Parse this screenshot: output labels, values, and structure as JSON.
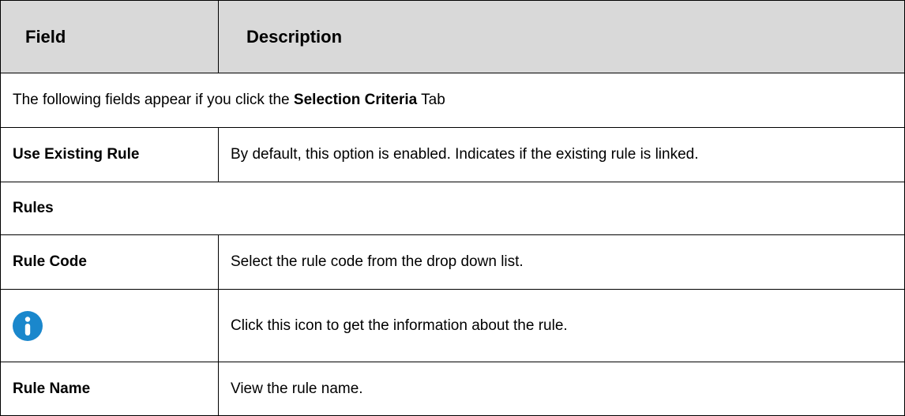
{
  "table": {
    "header": {
      "field": "Field",
      "description": "Description"
    },
    "note": {
      "prefix": "The following fields appear if you click the ",
      "emphasis": "Selection Criteria",
      "suffix": " Tab"
    },
    "rows": [
      {
        "field": "Use Existing Rule",
        "description": "By default, this option is enabled. Indicates if the existing rule is linked."
      }
    ],
    "section": {
      "title": "Rules"
    },
    "rule_rows": [
      {
        "field": "Rule Code",
        "description": "Select the rule code from the drop down list."
      },
      {
        "field_icon": "info-icon",
        "description": "Click this icon to get the information about the rule."
      },
      {
        "field": "Rule Name",
        "description": "View the rule name."
      }
    ]
  },
  "colors": {
    "header_background": "#d9d9d9",
    "border": "#000000",
    "info_icon": "#1a87cc"
  }
}
